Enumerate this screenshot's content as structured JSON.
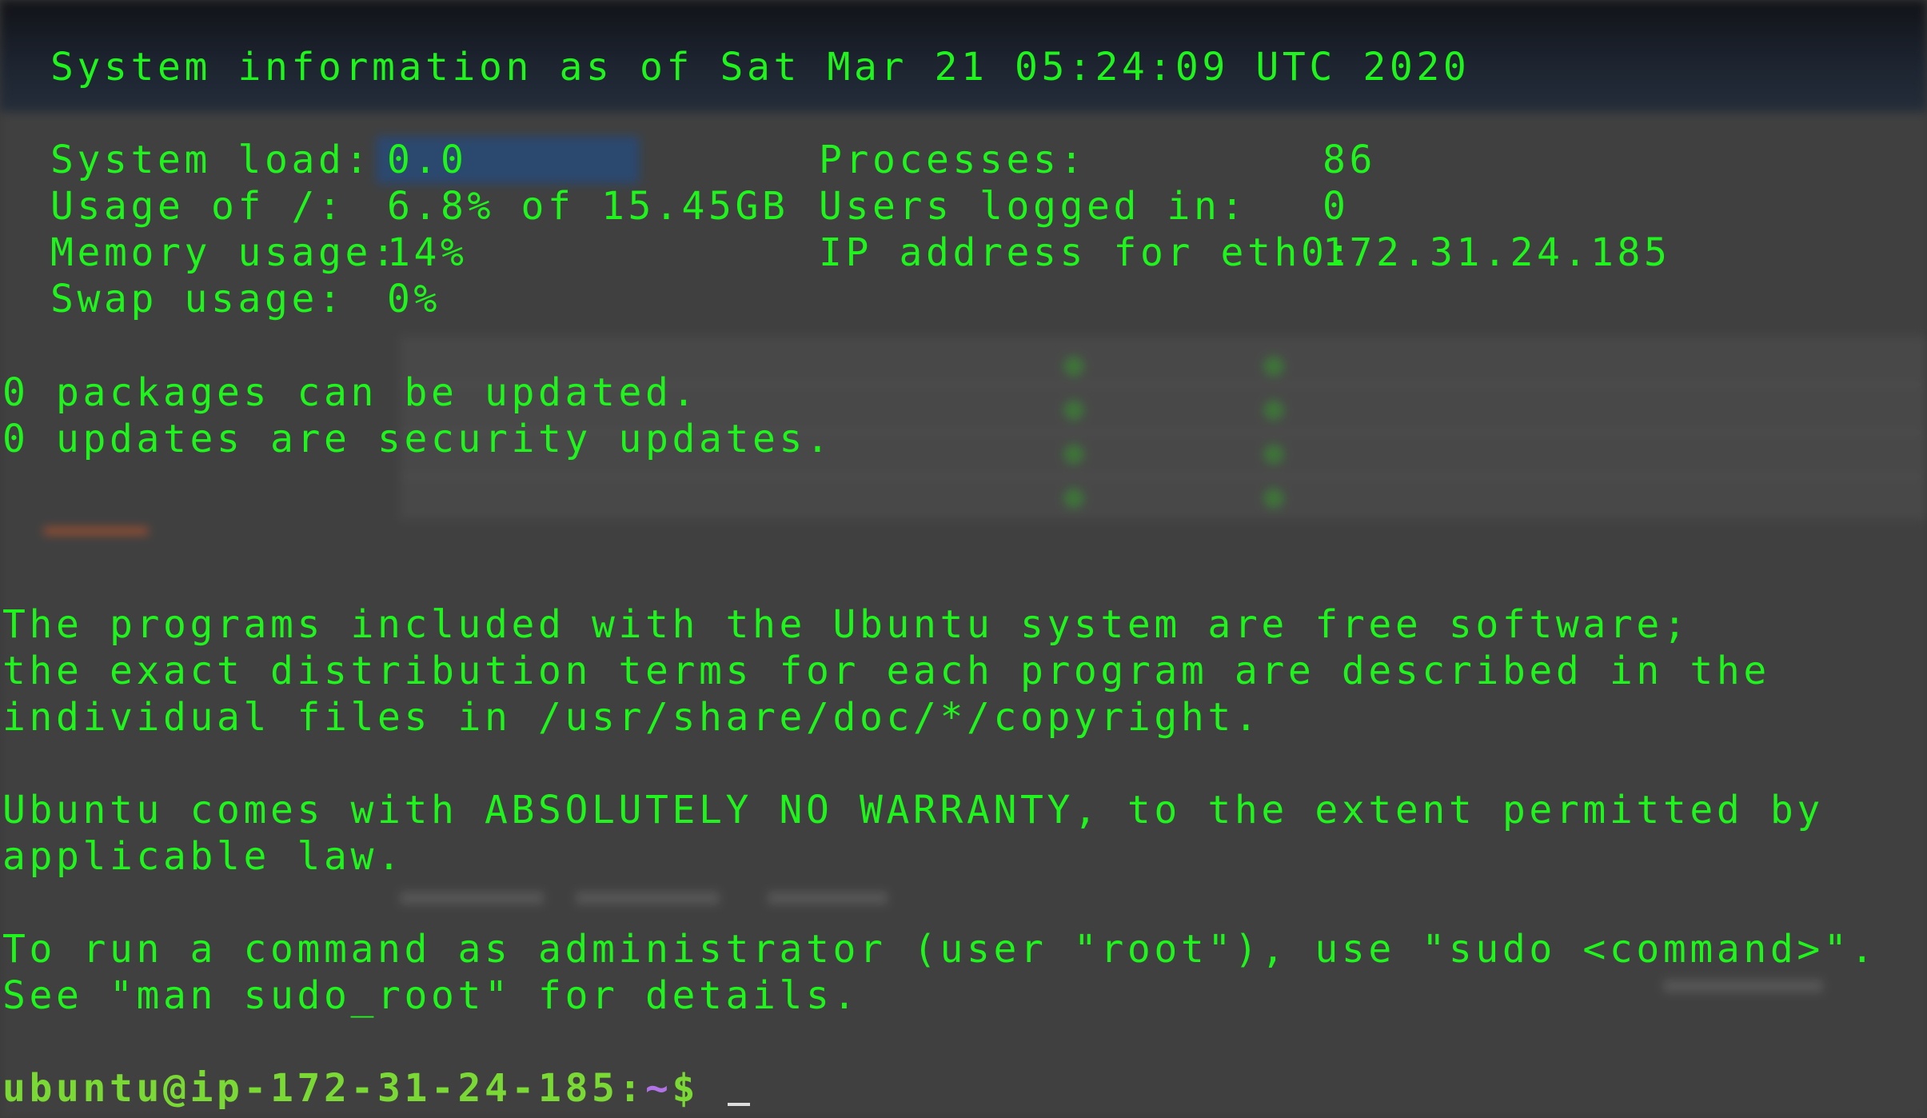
{
  "header": {
    "sysinfo": "System information as of Sat Mar 21 05:24:09 UTC 2020"
  },
  "stats": {
    "system_load_label": "System load:",
    "system_load_value": "0.0",
    "usage_label": "Usage of /:",
    "usage_value": "6.8% of 15.45GB",
    "memory_label": "Memory usage:",
    "memory_value": "14%",
    "swap_label": "Swap usage:",
    "swap_value": "0%",
    "processes_label": "Processes:",
    "processes_value": "86",
    "users_label": "Users logged in:",
    "users_value": "0",
    "ip_label": "IP address for eth0:",
    "ip_value": "172.31.24.185"
  },
  "updates": {
    "packages": "0 packages can be updated.",
    "security": "0 updates are security updates."
  },
  "license": {
    "line1": "The programs included with the Ubuntu system are free software;",
    "line2": "the exact distribution terms for each program are described in the",
    "line3": "individual files in /usr/share/doc/*/copyright."
  },
  "warranty": {
    "line1": "Ubuntu comes with ABSOLUTELY NO WARRANTY, to the extent permitted by",
    "line2": "applicable law."
  },
  "sudo": {
    "line1": "To run a command as administrator (user \"root\"), use \"sudo <command>\".",
    "line2": "See \"man sudo_root\" for details."
  },
  "prompt": {
    "user_host": "ubuntu@ip-172-31-24-185",
    "colon": ":",
    "path": "~",
    "symbol": "$"
  },
  "colors": {
    "terminal_text": "#1ff41d",
    "prompt_user": "#7ad934",
    "prompt_path": "#b373e8"
  }
}
